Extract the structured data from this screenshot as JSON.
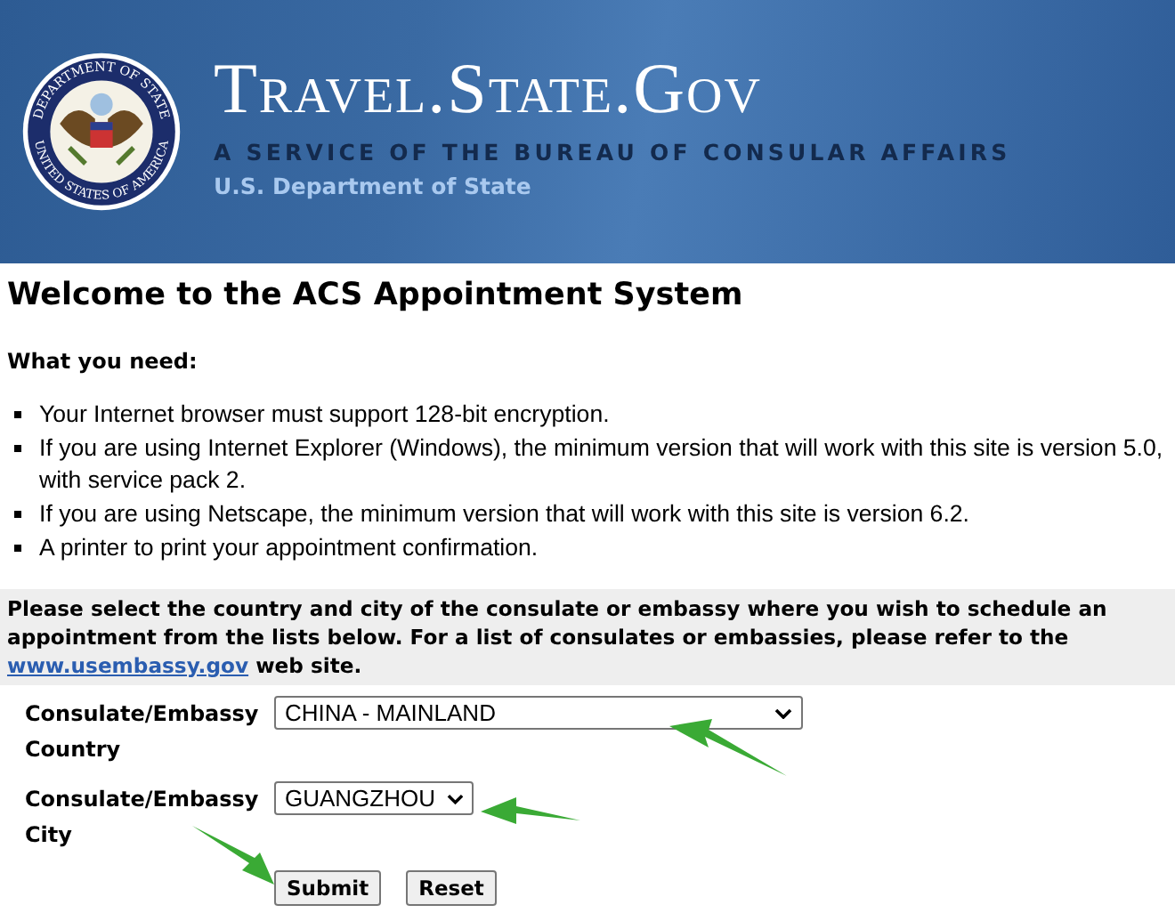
{
  "header": {
    "seal_top": "DEPARTMENT OF STATE",
    "seal_bottom": "UNITED STATES OF AMERICA",
    "title": "Travel.State.Gov",
    "tagline": "A SERVICE OF THE BUREAU OF CONSULAR AFFAIRS",
    "department": "U.S. Department of State"
  },
  "heading": "Welcome to the ACS Appointment System",
  "needs_title": "What you need:",
  "needs": [
    "Your Internet browser must support 128-bit encryption.",
    "If you are using Internet Explorer (Windows), the minimum version that will work with this site is version 5.0, with service pack 2.",
    "If you are using Netscape, the minimum version that will work with this site is version 6.2.",
    "A printer to print your appointment confirmation."
  ],
  "instructions": {
    "before": "Please select the country and city of the consulate or embassy where you wish to schedule an appointment from the lists below. For a list of consulates or embassies, please refer to the",
    "link": "www.usembassy.gov",
    "after": "web site."
  },
  "form": {
    "fields": [
      {
        "label": "Consulate/Embassy Country",
        "value": "CHINA - MAINLAND",
        "kind": "wide"
      },
      {
        "label": "Consulate/Embassy City",
        "value": "GUANGZHOU",
        "kind": "narrow"
      }
    ],
    "buttons": [
      "Submit",
      "Reset"
    ]
  }
}
